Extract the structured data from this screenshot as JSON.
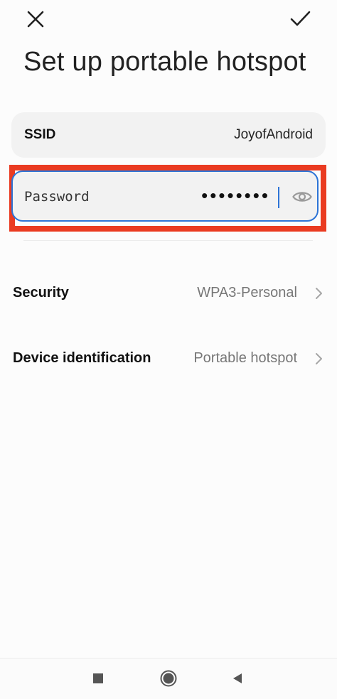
{
  "header": {
    "close_icon": "close-icon",
    "confirm_icon": "check-icon",
    "title": "Set up portable hotspot"
  },
  "ssid": {
    "label": "SSID",
    "value": "JoyofAndroid"
  },
  "password": {
    "label": "Password",
    "masked_value": "••••••••",
    "visibility_icon": "eye-icon",
    "highlight_color": "#ea3b21",
    "focus_color": "#2d74d6"
  },
  "settings": {
    "security": {
      "label": "Security",
      "value": "WPA3-Personal"
    },
    "device_identification": {
      "label": "Device identification",
      "value": "Portable hotspot"
    }
  },
  "navigation": {
    "recents_icon": "square-icon",
    "home_icon": "circle-icon",
    "back_icon": "triangle-back-icon"
  }
}
